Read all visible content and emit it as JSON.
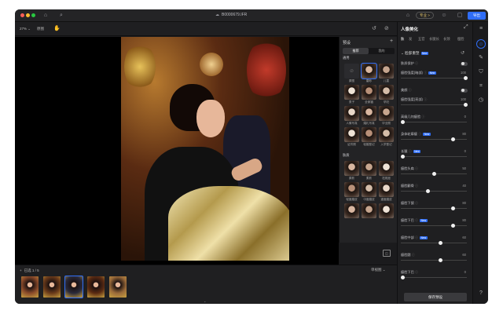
{
  "window": {
    "title": "B0000679.IFR",
    "pro_label": "专业 >",
    "export_label": "导出"
  },
  "toolbar": {
    "zoom": "27% ⌄",
    "original": "原图"
  },
  "preset_panel": {
    "title": "预设",
    "tabs": [
      {
        "label": "推荐",
        "active": true
      },
      {
        "label": "我的",
        "active": false
      }
    ],
    "categories": [
      {
        "name": "通用",
        "items": [
          "原图",
          "磨砂",
          "儿童",
          "男子",
          "全家福",
          "孕妇",
          "人像写真",
          "婚礼写真",
          "毕业照",
          "证件照",
          "轻婚登记",
          "入学登记"
        ]
      },
      {
        "name": "肤质",
        "items": [
          "原肤",
          "柔肤",
          "祛斑痘",
          "轻度磨皮",
          "中度磨皮",
          "重度磨皮",
          "",
          "",
          ""
        ]
      }
    ]
  },
  "filmstrip": {
    "counter": "已选 1 / 5",
    "view": "单视图 ⌄",
    "selected_index": 2
  },
  "right_panel": {
    "title": "人像美化",
    "tabs": [
      {
        "label": "肤",
        "active": true
      },
      {
        "label": "发",
        "active": false
      },
      {
        "label": "五官",
        "active": false
      },
      {
        "label": "长腿长",
        "active": false
      },
      {
        "label": "长颈",
        "active": false
      },
      {
        "label": "瘦脸",
        "active": false
      }
    ],
    "section": {
      "title": "脸部重塑",
      "badge": "New"
    },
    "rows": [
      {
        "label": "肤质保护",
        "kind": "toggle"
      },
      {
        "label": "瘦脸强度(暗部)",
        "badge": "New",
        "kind": "slider",
        "value": "100",
        "level": 1.0
      },
      {
        "label": "美颜",
        "kind": "toggle"
      },
      {
        "label": "瘦脸强度(亮部)",
        "kind": "slider",
        "value": "100",
        "level": 1.0
      },
      {
        "label": "高级几何瘦脸",
        "kind": "slider",
        "value": "0",
        "level": 0.0
      },
      {
        "label": "身体轮廓瘦",
        "badge": "New",
        "kind": "slider",
        "value": "80",
        "level": 0.8
      },
      {
        "label": "长腿",
        "badge": "New",
        "kind": "slider",
        "value": "0",
        "level": 0.0
      },
      {
        "label": "瘦脸头肩",
        "kind": "slider",
        "value": "50",
        "level": 0.5
      },
      {
        "label": "瘦脸颧骨",
        "kind": "slider",
        "value": "40",
        "level": 0.4
      },
      {
        "label": "瘦脸下颌",
        "kind": "slider",
        "value": "80",
        "level": 0.8
      },
      {
        "label": "瘦脸下巴",
        "badge": "New",
        "kind": "slider",
        "value": "80",
        "level": 0.8
      },
      {
        "label": "瘦脸中部",
        "badge": "New",
        "kind": "slider",
        "value": "60",
        "level": 0.6
      },
      {
        "label": "瘦脸腮",
        "kind": "slider",
        "value": "60",
        "level": 0.6
      },
      {
        "label": "瘦脸下巴",
        "kind": "slider",
        "value": "0",
        "level": 0.0
      }
    ],
    "save_label": "保存预设"
  }
}
